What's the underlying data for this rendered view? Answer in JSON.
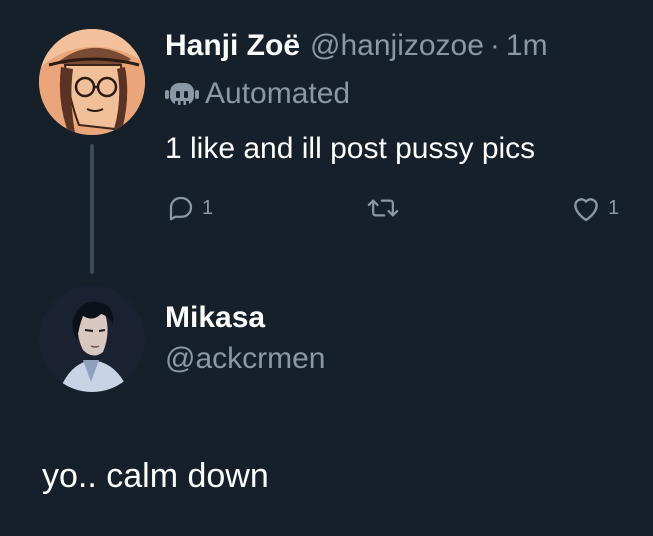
{
  "tweet": {
    "author": {
      "display_name": "Hanji Zoë",
      "handle": "@hanjizozoe",
      "separator": "·",
      "time": "1m",
      "label": "Automated",
      "label_icon": "bot-icon"
    },
    "text": "1 like and ill post pussy pics",
    "actions": {
      "reply_count": "1",
      "retweet_count": "",
      "like_count": "1"
    }
  },
  "reply_account": {
    "display_name": "Mikasa",
    "handle": "@ackcrmen"
  },
  "reply_text": "yo.. calm down",
  "colors": {
    "background": "#15202b",
    "text": "#ffffff",
    "muted": "#8b98a5",
    "thread_line": "#3d4b59"
  }
}
